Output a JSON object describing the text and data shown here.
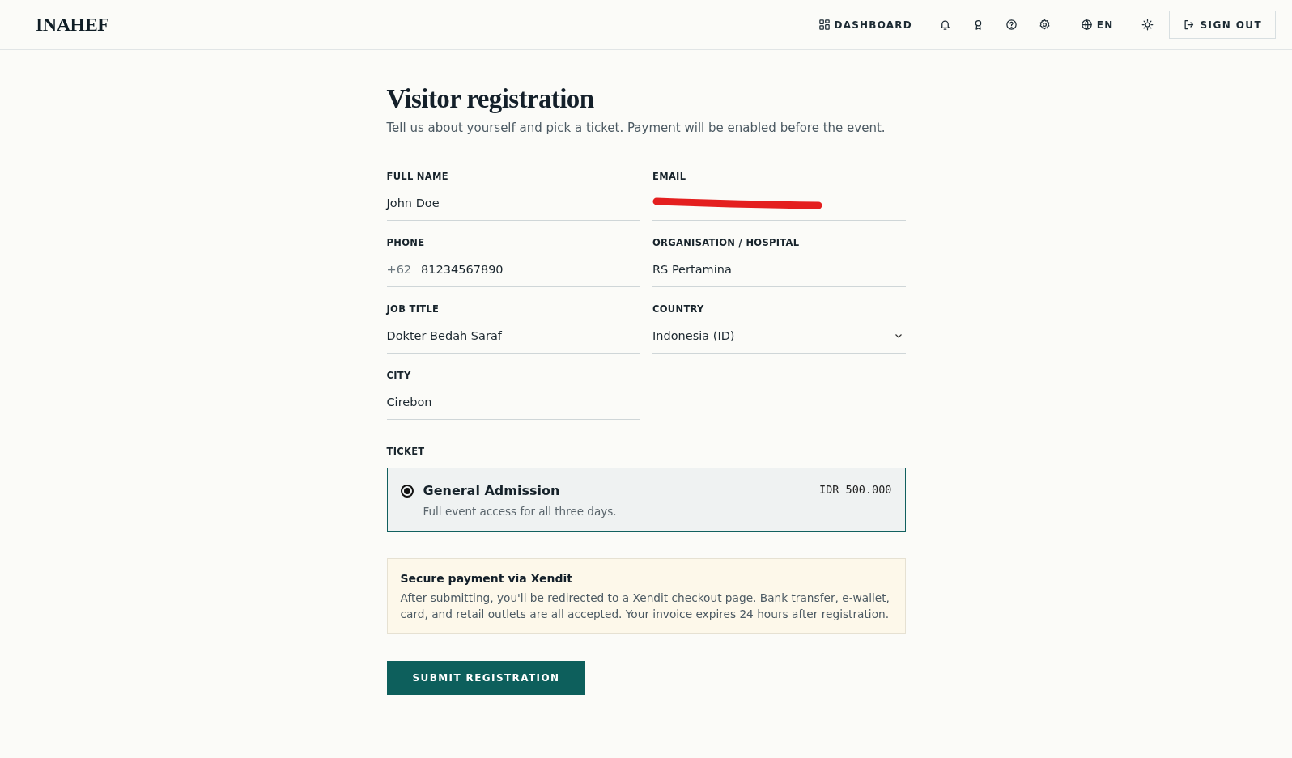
{
  "header": {
    "logo": "INAHEF",
    "nav": [
      {
        "kind": "link",
        "label": "DASHBOARD"
      },
      {
        "kind": "icon"
      },
      {
        "kind": "icon"
      },
      {
        "kind": "icon"
      },
      {
        "kind": "icon"
      },
      {
        "kind": "link",
        "label": "EN"
      },
      {
        "kind": "icon"
      },
      {
        "kind": "button",
        "label": "SIGN OUT"
      }
    ]
  },
  "title": "Visitor registration",
  "subtitle": "Tell us about yourself and pick a ticket. Payment will be enabled before the event.",
  "fields": [
    {
      "kind": "text",
      "label": "FULL NAME",
      "value": "John Doe"
    },
    {
      "kind": "redacted",
      "label": "EMAIL"
    },
    {
      "kind": "phone",
      "label": "PHONE",
      "prefix": "+62",
      "value": "81234567890"
    },
    {
      "kind": "text",
      "label": "ORGANISATION / HOSPITAL",
      "value": "RS Pertamina"
    },
    {
      "kind": "text",
      "label": "JOB TITLE",
      "value": "Dokter Bedah Saraf"
    },
    {
      "kind": "select",
      "label": "COUNTRY",
      "value": "Indonesia (ID)"
    },
    {
      "kind": "text",
      "label": "CITY",
      "value": "Cirebon"
    }
  ],
  "ticket": {
    "label": "TICKET",
    "options": [
      {
        "name": "General Admission",
        "description": "Full event access for all three days.",
        "price": "IDR 500.000",
        "selected": true
      }
    ]
  },
  "notice": {
    "title": "Secure payment via Xendit",
    "text": "After submitting, you'll be redirected to a Xendit checkout page. Bank transfer, e-wallet, card, and retail outlets are all accepted. Your invoice expires 24 hours after registration."
  },
  "submit": "SUBMIT REGISTRATION"
}
